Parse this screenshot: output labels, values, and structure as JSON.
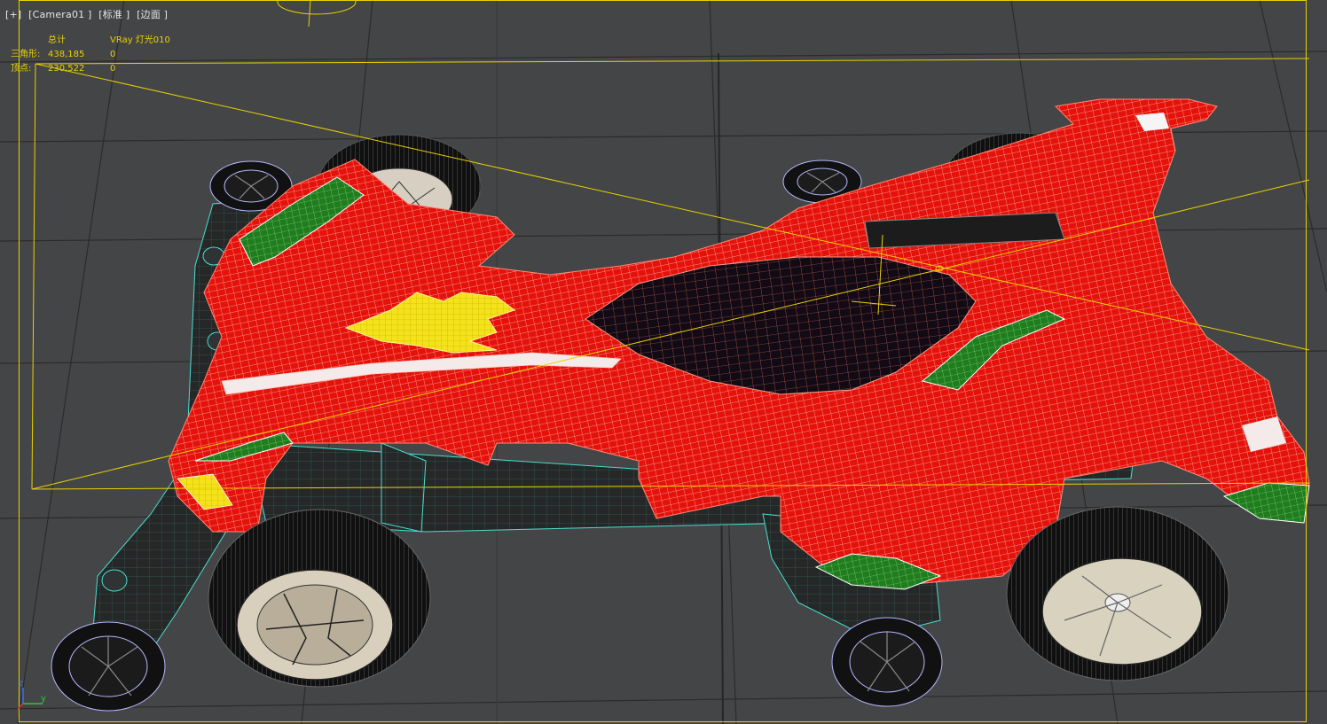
{
  "viewport": {
    "labels": [
      "[+]",
      "[Camera01 ]",
      "[标准 ]",
      "[边面 ]"
    ]
  },
  "stats": {
    "header_total": "总计",
    "header_object": "VRay 灯光010",
    "rows": [
      {
        "label": "三角形:",
        "total": "438,185",
        "object": "0"
      },
      {
        "label": "顶点:",
        "total": "230,522",
        "object": "0"
      }
    ]
  },
  "axis": {
    "z": "z",
    "y": "y"
  },
  "colors": {
    "viewport_bg": "#444546",
    "grid": "#2b2b2c",
    "selection": "#e8d200",
    "body": "#e5120c",
    "wire": "#ffb7a6",
    "green": "#1f7d1e",
    "chassis": "#48ded1",
    "wheel_wire": "#b7b7ff"
  }
}
